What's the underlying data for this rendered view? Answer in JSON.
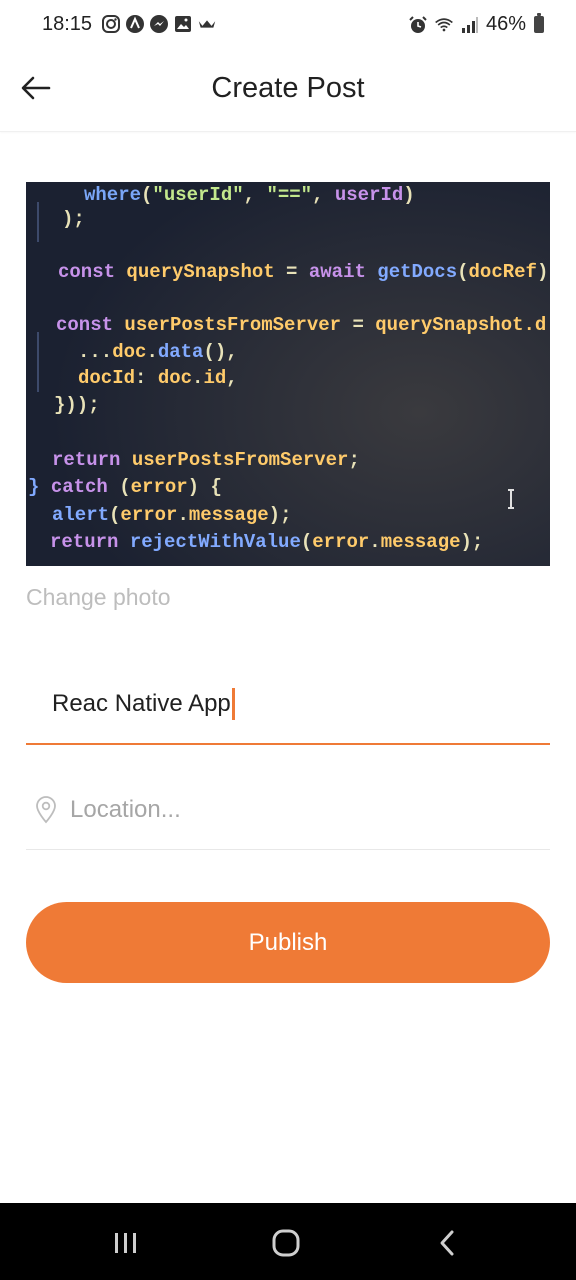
{
  "status_bar": {
    "time": "18:15",
    "battery": "46%",
    "left_icons": [
      "instagram-icon",
      "app-icon",
      "messenger-icon",
      "gallery-icon",
      "crown-icon"
    ],
    "right_icons": [
      "alarm-icon",
      "wifi-icon",
      "signal-icon",
      "battery-icon"
    ]
  },
  "header": {
    "title": "Create Post",
    "back_icon": "arrow-left-icon"
  },
  "photo": {
    "change_label": "Change photo",
    "code_lines": [
      "where(\"userId\", \"==\", userId)",
      ");",
      "const querySnapshot = await getDocs(docRef)",
      "const userPostsFromServer = querySnapshot.d",
      "...doc.data(),",
      "docId: doc.id,",
      "}));",
      "return userPostsFromServer;",
      "} catch (error) {",
      "alert(error.message);",
      "return rejectWithValue(error.message);"
    ]
  },
  "form": {
    "title_value": "Reac Native App",
    "location_placeholder": "Location...",
    "publish_label": "Publish"
  },
  "colors": {
    "accent": "#ef7a36",
    "placeholder": "#bdbdbd"
  },
  "nav": {
    "items": [
      "recents-icon",
      "home-icon",
      "back-icon"
    ]
  }
}
